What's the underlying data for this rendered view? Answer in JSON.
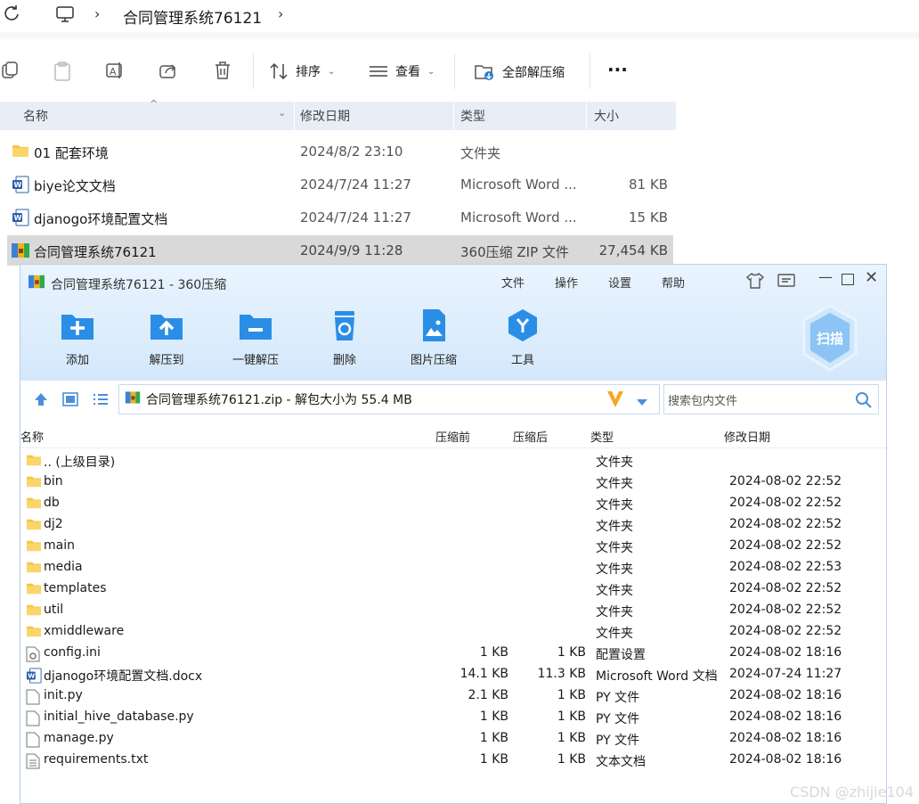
{
  "explorer": {
    "breadcrumb": [
      "合同管理系统76121"
    ],
    "toolbar": {
      "sort": "排序",
      "view": "查看",
      "extract_all": "全部解压缩",
      "more": "···"
    },
    "columns": [
      "名称",
      "修改日期",
      "类型",
      "大小"
    ],
    "rows": [
      {
        "name": "01 配套环境",
        "date": "2024/8/2 23:10",
        "type": "文件夹",
        "size": ""
      },
      {
        "name": "biye论文文档",
        "date": "2024/7/24 11:27",
        "type": "Microsoft Word ...",
        "size": "81 KB"
      },
      {
        "name": "djanogo环境配置文档",
        "date": "2024/7/24 11:27",
        "type": "Microsoft Word ...",
        "size": "15 KB"
      },
      {
        "name": "合同管理系统76121",
        "date": "2024/9/9 11:28",
        "type": "360压缩 ZIP 文件",
        "size": "27,454 KB"
      }
    ]
  },
  "zip": {
    "title": "合同管理系统76121 - 360压缩",
    "menu": [
      "文件",
      "操作",
      "设置",
      "帮助"
    ],
    "tools": [
      "添加",
      "解压到",
      "一键解压",
      "删除",
      "图片压缩",
      "工具"
    ],
    "scan": "扫描",
    "path": "合同管理系统76121.zip - 解包大小为 55.4 MB",
    "search_placeholder": "搜索包内文件",
    "columns": [
      "名称",
      "压缩前",
      "压缩后",
      "类型",
      "修改日期"
    ],
    "rows": [
      {
        "name": ".. (上级目录)",
        "before": "",
        "after": "",
        "type": "文件夹",
        "date": ""
      },
      {
        "name": "bin",
        "before": "",
        "after": "",
        "type": "文件夹",
        "date": "2024-08-02 22:52"
      },
      {
        "name": "db",
        "before": "",
        "after": "",
        "type": "文件夹",
        "date": "2024-08-02 22:52"
      },
      {
        "name": "dj2",
        "before": "",
        "after": "",
        "type": "文件夹",
        "date": "2024-08-02 22:52"
      },
      {
        "name": "main",
        "before": "",
        "after": "",
        "type": "文件夹",
        "date": "2024-08-02 22:52"
      },
      {
        "name": "media",
        "before": "",
        "after": "",
        "type": "文件夹",
        "date": "2024-08-02 22:53"
      },
      {
        "name": "templates",
        "before": "",
        "after": "",
        "type": "文件夹",
        "date": "2024-08-02 22:52"
      },
      {
        "name": "util",
        "before": "",
        "after": "",
        "type": "文件夹",
        "date": "2024-08-02 22:52"
      },
      {
        "name": "xmiddleware",
        "before": "",
        "after": "",
        "type": "文件夹",
        "date": "2024-08-02 22:52"
      },
      {
        "name": "config.ini",
        "before": "1 KB",
        "after": "1 KB",
        "type": "配置设置",
        "date": "2024-08-02 18:16"
      },
      {
        "name": "djanogo环境配置文档.docx",
        "before": "14.1 KB",
        "after": "11.3 KB",
        "type": "Microsoft Word 文档",
        "date": "2024-07-24 11:27"
      },
      {
        "name": "init.py",
        "before": "2.1 KB",
        "after": "1 KB",
        "type": "PY 文件",
        "date": "2024-08-02 18:16"
      },
      {
        "name": "initial_hive_database.py",
        "before": "1 KB",
        "after": "1 KB",
        "type": "PY 文件",
        "date": "2024-08-02 18:16"
      },
      {
        "name": "manage.py",
        "before": "1 KB",
        "after": "1 KB",
        "type": "PY 文件",
        "date": "2024-08-02 18:16"
      },
      {
        "name": "requirements.txt",
        "before": "1 KB",
        "after": "1 KB",
        "type": "文本文档",
        "date": "2024-08-02 18:16"
      }
    ]
  },
  "watermark": "CSDN @zhijie104"
}
